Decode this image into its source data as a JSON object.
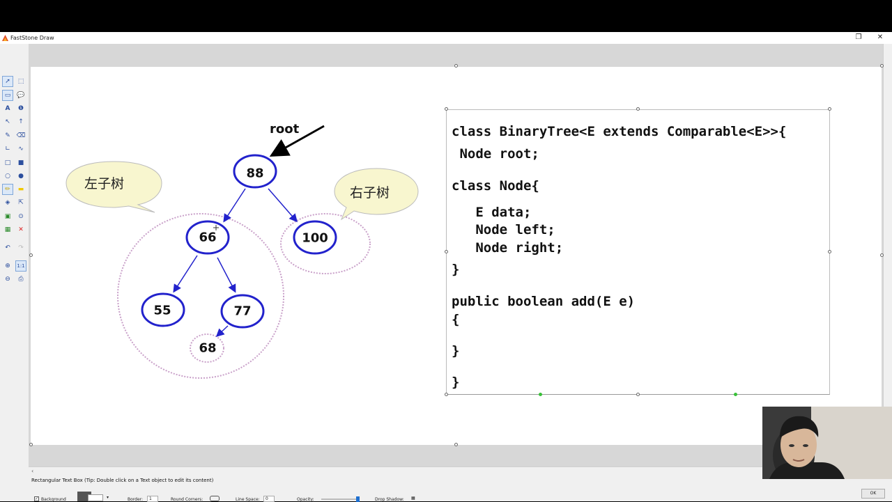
{
  "window": {
    "title": "FastStone Draw"
  },
  "status_tip": "Rectangular Text Box (Tip: Double click on a Text object to edit its content)",
  "props": {
    "background_label": "Background",
    "border_label": "Border:",
    "border_value": "1",
    "round_corners_label": "Round Corners:",
    "line_space_label": "Line Space:",
    "line_space_value": "0",
    "opacity_label": "Opacity:",
    "drop_shadow_label": "Drop Shadow:",
    "ok_label": "OK"
  },
  "diagram": {
    "root_label": "root",
    "left_subtree_label": "左子树",
    "right_subtree_label": "右子树",
    "nodes": {
      "n88": "88",
      "n66": "66",
      "n100": "100",
      "n55": "55",
      "n77": "77",
      "n68": "68"
    }
  },
  "code": {
    "line1": "class BinaryTree<E extends Comparable<E>>{",
    "line2": " Node root;",
    "line3": "class Node{",
    "line4": "   E data;",
    "line5": "   Node left;",
    "line6": "   Node right;",
    "line7": "}",
    "line8": "public boolean add(E e)",
    "line9": "{",
    "line10": "}",
    "line11": "}"
  },
  "colors": {
    "node_stroke": "#2222cc",
    "subtree_outline": "#c9a0c9",
    "bubble_fill": "#f8f6cf"
  }
}
